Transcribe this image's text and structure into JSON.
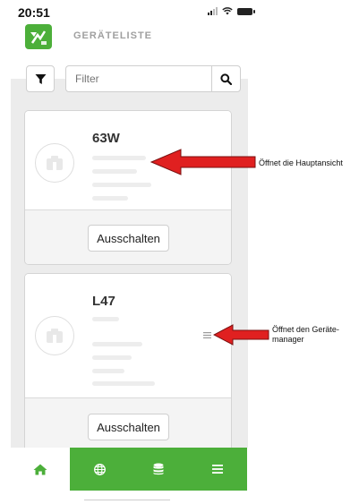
{
  "status_bar": {
    "time": "20:51"
  },
  "header": {
    "title": "GERÄTELISTE"
  },
  "search": {
    "placeholder": "Filter"
  },
  "devices": [
    {
      "name": "63W",
      "button_label": "Ausschalten"
    },
    {
      "name": "L47",
      "button_label": "Ausschalten"
    }
  ],
  "annotations": [
    "Öffnet die Hauptansicht",
    "Öffnet den Geräte-\nmanager"
  ],
  "nav": {
    "items": [
      "home-icon",
      "globe-icon",
      "database-icon",
      "menu-icon"
    ]
  },
  "colors": {
    "brand_green": "#4caf3a",
    "annotation_arrow": "#e02020"
  }
}
